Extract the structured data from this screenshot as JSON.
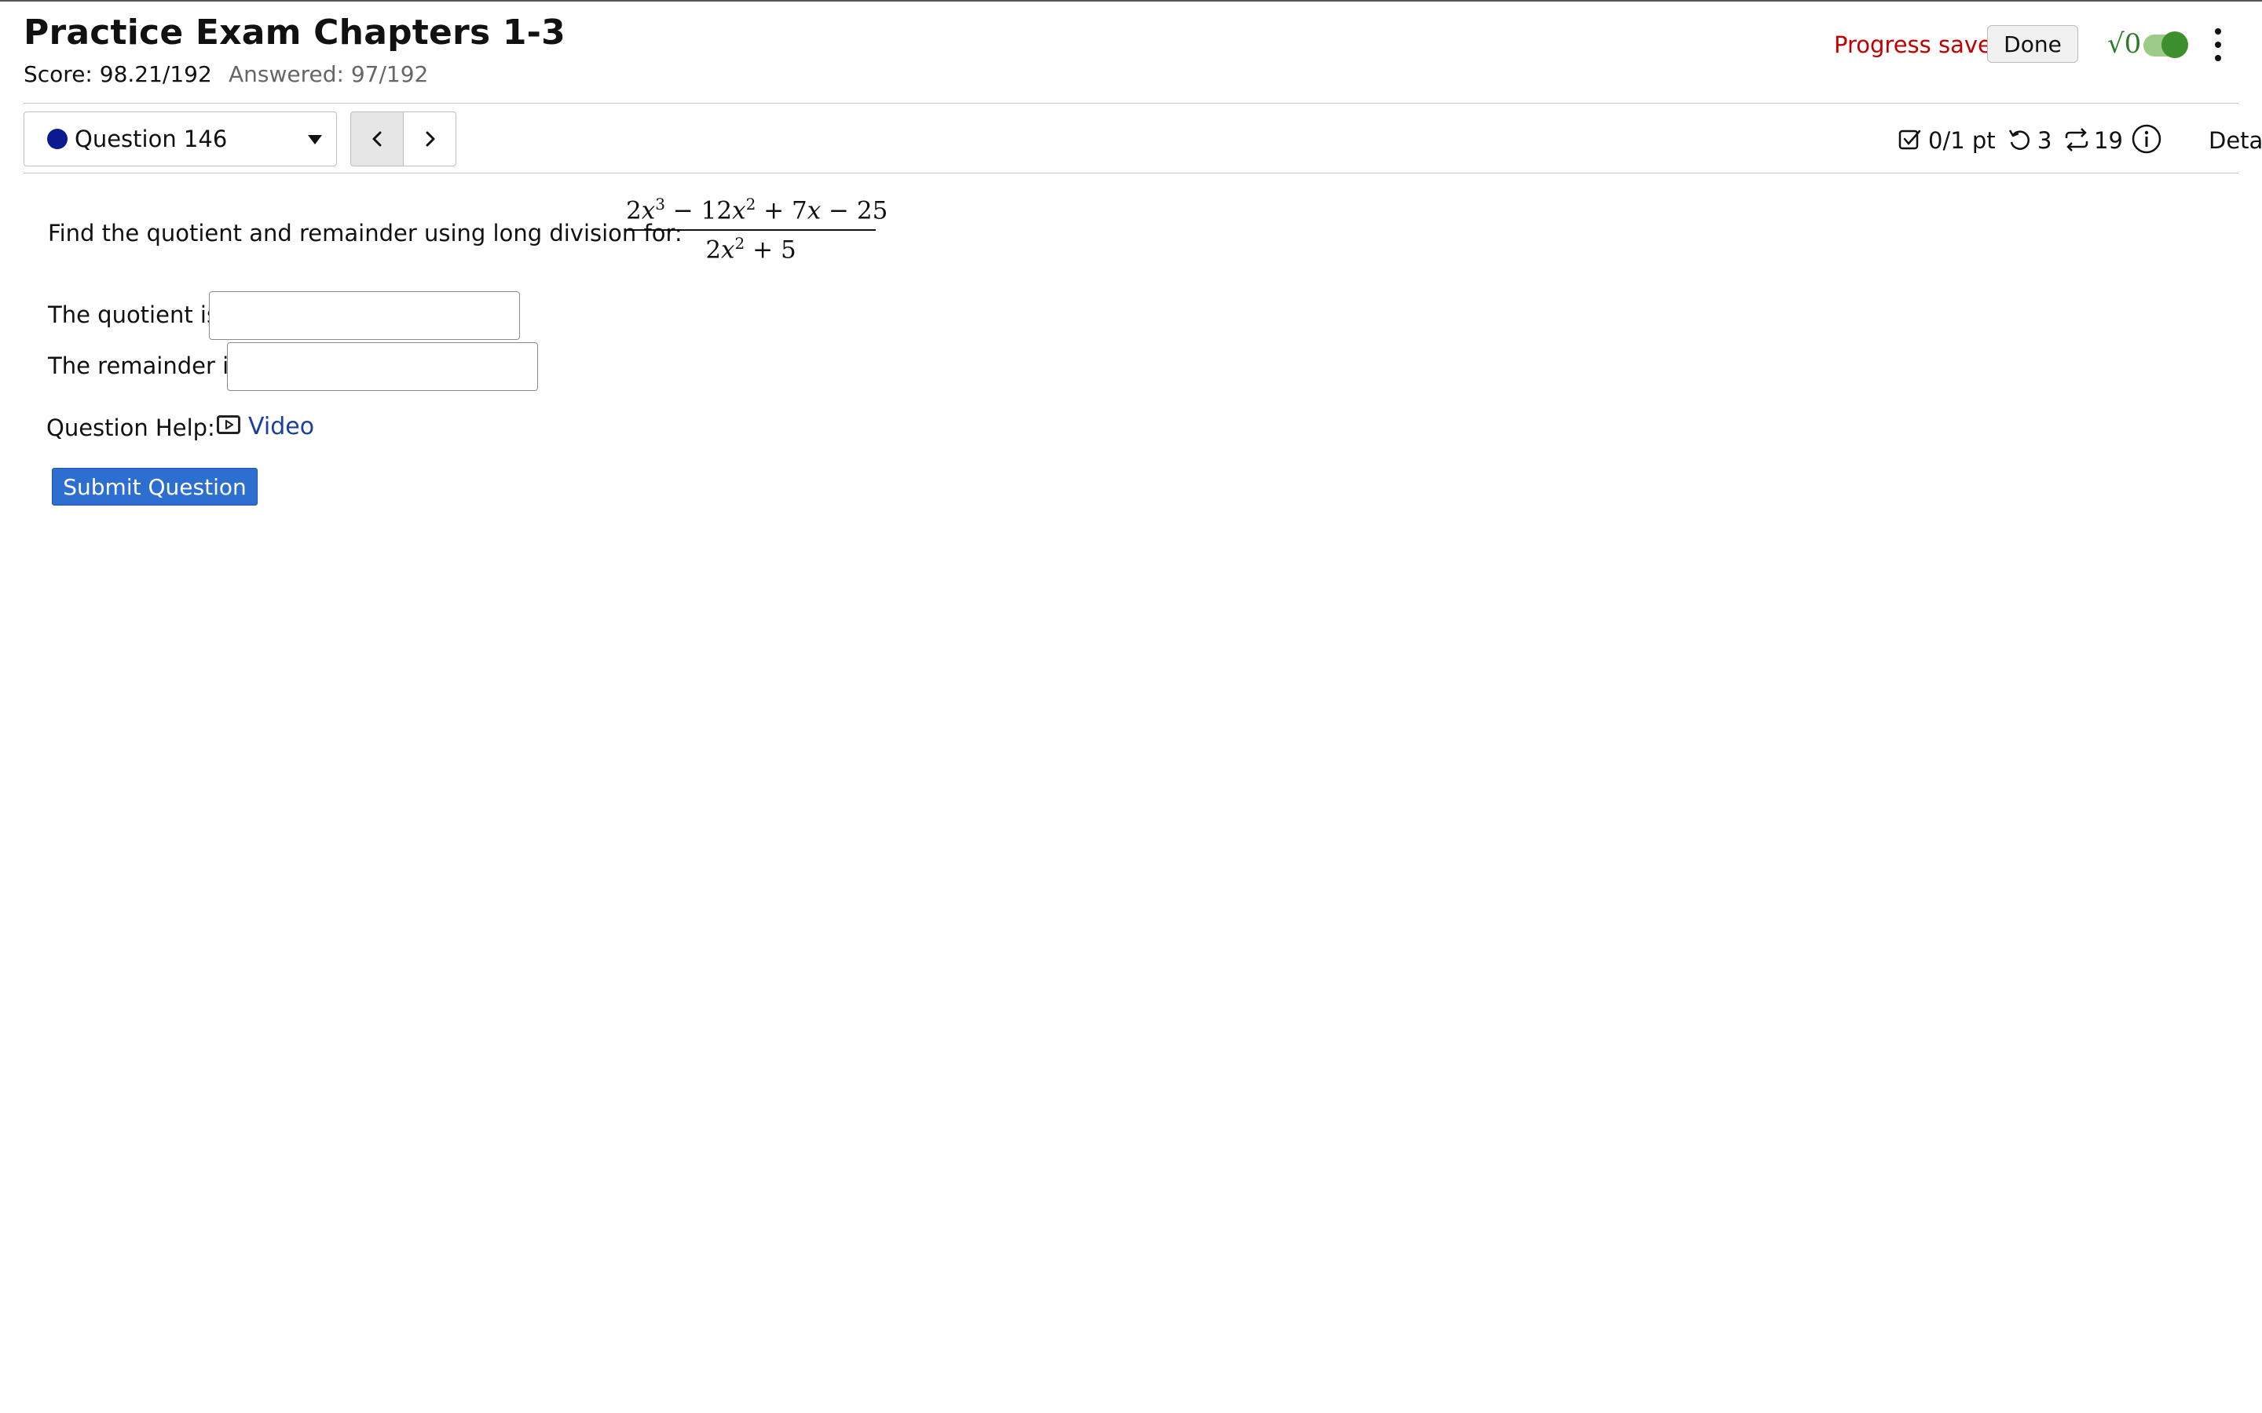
{
  "header": {
    "title": "Practice Exam Chapters 1-3",
    "score": "Score: 98.21/192",
    "answered": "Answered: 97/192",
    "progress_status": "Progress saved",
    "done_label": "Done",
    "math_toggle_glyph": "√0",
    "math_toggle_on": true
  },
  "nav": {
    "question_selector": "Question 146",
    "prev_icon": "chevron-left-icon",
    "next_icon": "chevron-right-icon"
  },
  "meta": {
    "points": "0/1 pt",
    "tries": "3",
    "versions": "19",
    "details_label": "Details"
  },
  "question": {
    "prompt": "Find the quotient and remainder using long division for:",
    "numerator": "2x³ − 12x² + 7x − 25",
    "denominator": "2x² + 5",
    "quotient_label": "The quotient is",
    "quotient_value": "",
    "remainder_label": "The remainder is",
    "remainder_value": "",
    "help_label": "Question Help:",
    "video_label": "Video",
    "submit_label": "Submit Question"
  },
  "colors": {
    "progress_saved": "#c00000",
    "submit_button": "#2d6fd0",
    "link": "#1a3fa0",
    "toggle_on": "#3e8f2e"
  }
}
